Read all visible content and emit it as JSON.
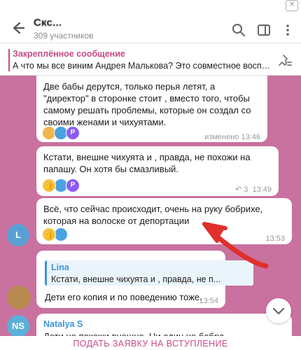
{
  "colors": {
    "accent": "#c94a85",
    "chat_background": "#c9719f",
    "arrow": "#e0302c",
    "link_blue": "#3b94d9"
  },
  "header": {
    "title": "Скс...",
    "members": "309 участников",
    "icons": [
      "back-arrow-icon",
      "search-icon",
      "sidebar-icon",
      "more-vert-icon"
    ]
  },
  "pinned": {
    "label": "Закреплённое сообщение",
    "text": "А что мы все виним Андрея Малькова? Это совместное воспи..."
  },
  "messages": [
    {
      "text": "Две бабы дерутся, только перья летят, а \"директор\" в сторонке стоит , вместо того, чтобы самому решать проблемы, которые он создал со своими женами и чихуятами.",
      "meta": "изменено 13:46",
      "reactions": [
        "clap",
        "blue",
        "purple"
      ]
    },
    {
      "text": "Кстати, внешне чихуята и , правда, не похожи на папашу. Он хотя бы смазливый.",
      "reply_count": "3",
      "time": "13:49",
      "reactions": [
        "thumb",
        "blue",
        "purple"
      ]
    },
    {
      "text": "Всё, что сейчас происходит, очень на руку бобрихе, которая на волоске от депортации",
      "time": "13:53",
      "avatar_letter": "L",
      "reactions": [
        "thumb",
        "blue"
      ]
    },
    {
      "quote_name": "Lina",
      "quote_text": "Кстати, внешне чихуята и , правда, не п...",
      "text": "Дети его копия и по поведению тоже.",
      "time": "13:54"
    },
    {
      "sender": "Natalya S",
      "avatar_letters": "NS",
      "text": "Дети не похожи внешне. Ни один не бобра"
    }
  ],
  "bottom": {
    "join_label": "ПОДАТЬ ЗАЯВКУ НА ВСТУПЛЕНИЕ"
  }
}
